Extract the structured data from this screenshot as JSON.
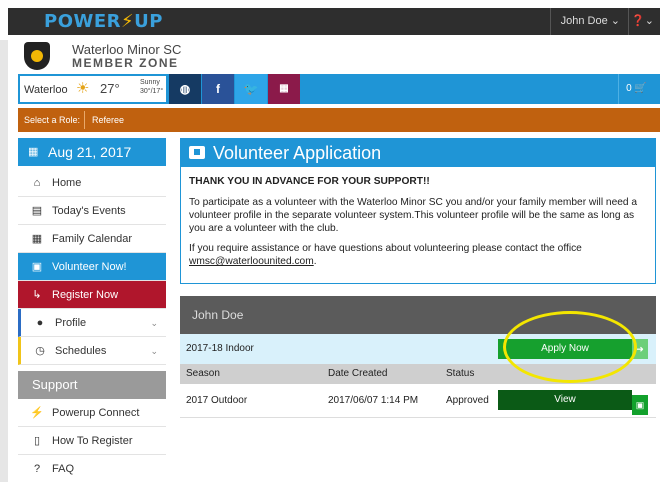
{
  "topbar": {
    "logo_left": "POWER",
    "logo_bolt": "⚡",
    "logo_right": "UP",
    "user": "John Doe ⌄",
    "help": "❓⌄"
  },
  "club": {
    "name": "Waterloo Minor SC",
    "zone": "MEMBER ZONE"
  },
  "weather": {
    "city": "Waterloo",
    "icon": "☀",
    "temp": "27°",
    "condition": "Sunny",
    "range": "30°/17°"
  },
  "social": {
    "web": "◍",
    "facebook": "f",
    "twitter": "🐦",
    "calendar": "▦",
    "cart": "0 🛒"
  },
  "role": {
    "label": "Select a Role:",
    "value": "Referee"
  },
  "sidebar": {
    "date": "Aug 21, 2017",
    "items": [
      {
        "label": "Home",
        "icon": "⌂"
      },
      {
        "label": "Today's Events",
        "icon": "▤"
      },
      {
        "label": "Family Calendar",
        "icon": "▦"
      },
      {
        "label": "Volunteer Now!",
        "icon": "▣"
      },
      {
        "label": "Register Now",
        "icon": "↳"
      },
      {
        "label": "Profile",
        "icon": "●"
      },
      {
        "label": "Schedules",
        "icon": "◷"
      }
    ],
    "support_title": "Support",
    "support_items": [
      {
        "label": "Powerup Connect",
        "icon": "⚡"
      },
      {
        "label": "How To Register",
        "icon": "▯"
      },
      {
        "label": "FAQ",
        "icon": "?"
      }
    ]
  },
  "panel": {
    "title": "Volunteer Application",
    "lead": "THANK YOU IN ADVANCE FOR YOUR SUPPORT!!",
    "para1": "To participate as a volunteer with the Waterloo Minor SC you and/or your family member will need a volunteer profile in the separate volunteer system.This volunteer profile will be the same as long as you are a volunteer with the club.",
    "para2": "If you require assistance or have questions about volunteering please contact the office",
    "email": "wmsc@waterloounited.com",
    "period": "."
  },
  "volunteer": {
    "name": "John Doe",
    "current_season": "2017-18 Indoor",
    "apply_label": "Apply Now",
    "apply_icon": "➜",
    "columns": {
      "season": "Season",
      "date": "Date Created",
      "status": "Status"
    },
    "row": {
      "season": "2017 Outdoor",
      "date": "2017/06/07 1:14 PM",
      "status": "Approved",
      "view_label": "View",
      "view_icon": "▣"
    }
  }
}
